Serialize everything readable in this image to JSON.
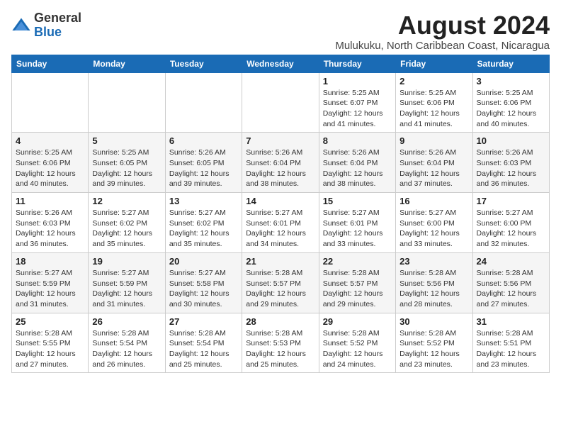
{
  "header": {
    "logo_line1": "General",
    "logo_line2": "Blue",
    "title": "August 2024",
    "subtitle": "Mulukuku, North Caribbean Coast, Nicaragua"
  },
  "weekdays": [
    "Sunday",
    "Monday",
    "Tuesday",
    "Wednesday",
    "Thursday",
    "Friday",
    "Saturday"
  ],
  "weeks": [
    [
      {
        "day": "",
        "info": ""
      },
      {
        "day": "",
        "info": ""
      },
      {
        "day": "",
        "info": ""
      },
      {
        "day": "",
        "info": ""
      },
      {
        "day": "1",
        "info": "Sunrise: 5:25 AM\nSunset: 6:07 PM\nDaylight: 12 hours\nand 41 minutes."
      },
      {
        "day": "2",
        "info": "Sunrise: 5:25 AM\nSunset: 6:06 PM\nDaylight: 12 hours\nand 41 minutes."
      },
      {
        "day": "3",
        "info": "Sunrise: 5:25 AM\nSunset: 6:06 PM\nDaylight: 12 hours\nand 40 minutes."
      }
    ],
    [
      {
        "day": "4",
        "info": "Sunrise: 5:25 AM\nSunset: 6:06 PM\nDaylight: 12 hours\nand 40 minutes."
      },
      {
        "day": "5",
        "info": "Sunrise: 5:25 AM\nSunset: 6:05 PM\nDaylight: 12 hours\nand 39 minutes."
      },
      {
        "day": "6",
        "info": "Sunrise: 5:26 AM\nSunset: 6:05 PM\nDaylight: 12 hours\nand 39 minutes."
      },
      {
        "day": "7",
        "info": "Sunrise: 5:26 AM\nSunset: 6:04 PM\nDaylight: 12 hours\nand 38 minutes."
      },
      {
        "day": "8",
        "info": "Sunrise: 5:26 AM\nSunset: 6:04 PM\nDaylight: 12 hours\nand 38 minutes."
      },
      {
        "day": "9",
        "info": "Sunrise: 5:26 AM\nSunset: 6:04 PM\nDaylight: 12 hours\nand 37 minutes."
      },
      {
        "day": "10",
        "info": "Sunrise: 5:26 AM\nSunset: 6:03 PM\nDaylight: 12 hours\nand 36 minutes."
      }
    ],
    [
      {
        "day": "11",
        "info": "Sunrise: 5:26 AM\nSunset: 6:03 PM\nDaylight: 12 hours\nand 36 minutes."
      },
      {
        "day": "12",
        "info": "Sunrise: 5:27 AM\nSunset: 6:02 PM\nDaylight: 12 hours\nand 35 minutes."
      },
      {
        "day": "13",
        "info": "Sunrise: 5:27 AM\nSunset: 6:02 PM\nDaylight: 12 hours\nand 35 minutes."
      },
      {
        "day": "14",
        "info": "Sunrise: 5:27 AM\nSunset: 6:01 PM\nDaylight: 12 hours\nand 34 minutes."
      },
      {
        "day": "15",
        "info": "Sunrise: 5:27 AM\nSunset: 6:01 PM\nDaylight: 12 hours\nand 33 minutes."
      },
      {
        "day": "16",
        "info": "Sunrise: 5:27 AM\nSunset: 6:00 PM\nDaylight: 12 hours\nand 33 minutes."
      },
      {
        "day": "17",
        "info": "Sunrise: 5:27 AM\nSunset: 6:00 PM\nDaylight: 12 hours\nand 32 minutes."
      }
    ],
    [
      {
        "day": "18",
        "info": "Sunrise: 5:27 AM\nSunset: 5:59 PM\nDaylight: 12 hours\nand 31 minutes."
      },
      {
        "day": "19",
        "info": "Sunrise: 5:27 AM\nSunset: 5:59 PM\nDaylight: 12 hours\nand 31 minutes."
      },
      {
        "day": "20",
        "info": "Sunrise: 5:27 AM\nSunset: 5:58 PM\nDaylight: 12 hours\nand 30 minutes."
      },
      {
        "day": "21",
        "info": "Sunrise: 5:28 AM\nSunset: 5:57 PM\nDaylight: 12 hours\nand 29 minutes."
      },
      {
        "day": "22",
        "info": "Sunrise: 5:28 AM\nSunset: 5:57 PM\nDaylight: 12 hours\nand 29 minutes."
      },
      {
        "day": "23",
        "info": "Sunrise: 5:28 AM\nSunset: 5:56 PM\nDaylight: 12 hours\nand 28 minutes."
      },
      {
        "day": "24",
        "info": "Sunrise: 5:28 AM\nSunset: 5:56 PM\nDaylight: 12 hours\nand 27 minutes."
      }
    ],
    [
      {
        "day": "25",
        "info": "Sunrise: 5:28 AM\nSunset: 5:55 PM\nDaylight: 12 hours\nand 27 minutes."
      },
      {
        "day": "26",
        "info": "Sunrise: 5:28 AM\nSunset: 5:54 PM\nDaylight: 12 hours\nand 26 minutes."
      },
      {
        "day": "27",
        "info": "Sunrise: 5:28 AM\nSunset: 5:54 PM\nDaylight: 12 hours\nand 25 minutes."
      },
      {
        "day": "28",
        "info": "Sunrise: 5:28 AM\nSunset: 5:53 PM\nDaylight: 12 hours\nand 25 minutes."
      },
      {
        "day": "29",
        "info": "Sunrise: 5:28 AM\nSunset: 5:52 PM\nDaylight: 12 hours\nand 24 minutes."
      },
      {
        "day": "30",
        "info": "Sunrise: 5:28 AM\nSunset: 5:52 PM\nDaylight: 12 hours\nand 23 minutes."
      },
      {
        "day": "31",
        "info": "Sunrise: 5:28 AM\nSunset: 5:51 PM\nDaylight: 12 hours\nand 23 minutes."
      }
    ]
  ]
}
